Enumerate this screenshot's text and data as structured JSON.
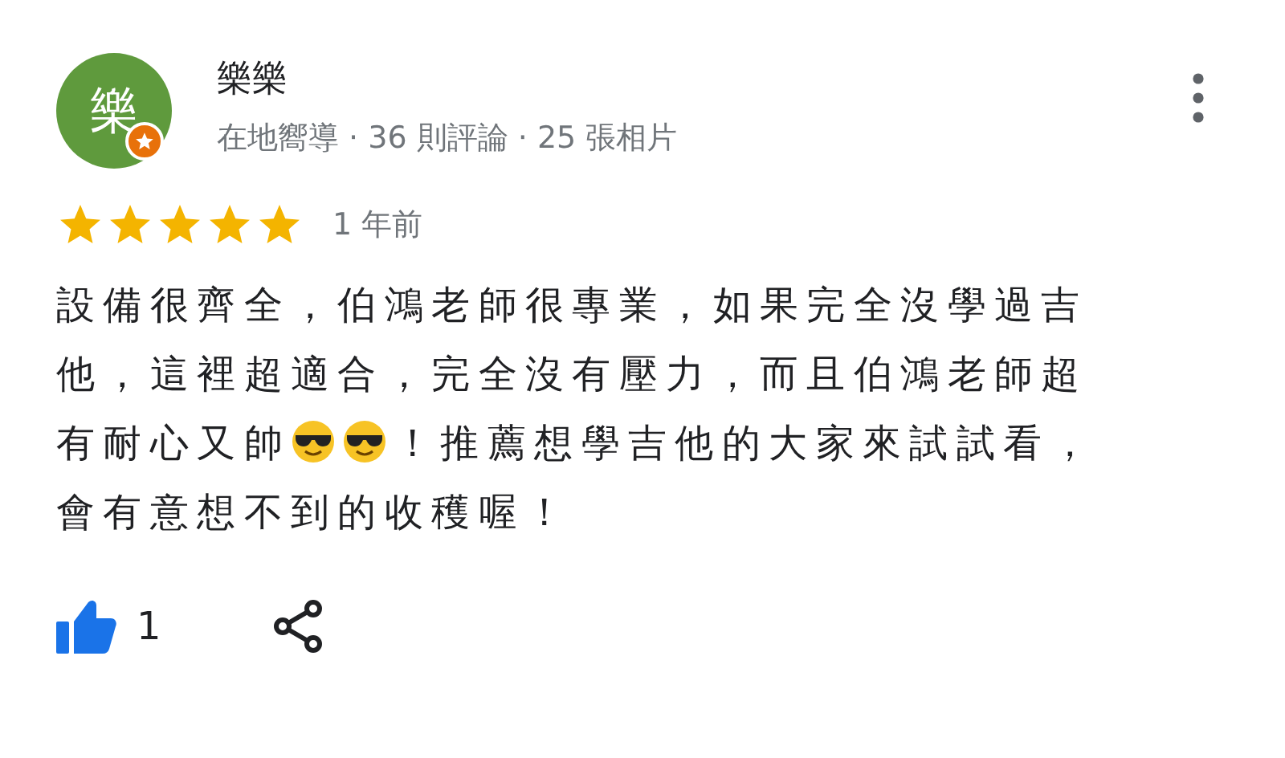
{
  "review": {
    "avatar_text": "樂",
    "local_guide": true,
    "name": "樂樂",
    "meta": "在地嚮導 · 36 則評論 · 25 張相片",
    "stars": 5,
    "time": "1 年前",
    "body_lines": [
      [
        {
          "kind": "text",
          "text": "設備很齊全，伯鴻老師很專業，如果完全沒學過吉"
        }
      ],
      [
        {
          "kind": "text",
          "text": "他，這裡超適合，完全沒有壓力，而且伯鴻老師超"
        }
      ],
      [
        {
          "kind": "text",
          "text": "有耐心又帥"
        },
        {
          "kind": "emoji"
        },
        {
          "kind": "emoji"
        },
        {
          "kind": "text",
          "text": "！推薦想學吉他的大家來試試看，"
        }
      ],
      [
        {
          "kind": "text",
          "text": "會有意想不到的收穫喔！"
        }
      ]
    ],
    "likes": "1"
  }
}
